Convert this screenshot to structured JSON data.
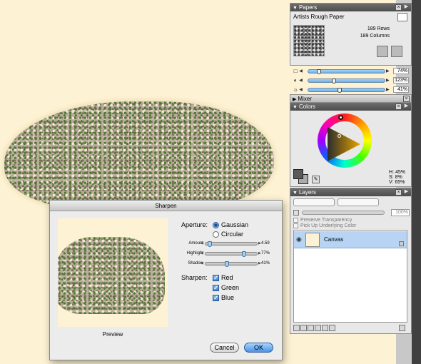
{
  "panels": {
    "papers": {
      "title": "Papers",
      "paper_name": "Artists Rough Paper",
      "rows": "189 Rows",
      "columns": "189 Columns",
      "sliders": [
        {
          "icon": "scale-icon",
          "value": "74%",
          "fraction": 0.12
        },
        {
          "icon": "contrast-icon",
          "value": "123%",
          "fraction": 0.33
        },
        {
          "icon": "brightness-icon",
          "value": "41%",
          "fraction": 0.41
        }
      ]
    },
    "mixer": {
      "title": "Mixer"
    },
    "colors": {
      "title": "Colors",
      "h": "H: 45%",
      "s": "S: 8%",
      "v": "V: 65%"
    },
    "layers": {
      "title": "Layers",
      "opacity": "100%",
      "preserve_transparency": "Preserve Transparency",
      "pick_up_color": "Pick Up Underlying Color",
      "layer_name": "Canvas"
    }
  },
  "dialog": {
    "title": "Sharpen",
    "preview_label": "Preview",
    "aperture_label": "Aperture:",
    "gaussian": "Gaussian",
    "circular": "Circular",
    "amount_label": "Amount",
    "amount_value": "4.59",
    "amount_fraction": 0.05,
    "highlight_label": "Highlight",
    "highlight_value": "77%",
    "highlight_fraction": 0.77,
    "shadow_label": "Shadow",
    "shadow_value": "41%",
    "shadow_fraction": 0.41,
    "sharpen_label": "Sharpen:",
    "red": "Red",
    "green": "Green",
    "blue": "Blue",
    "cancel": "Cancel",
    "ok": "OK"
  },
  "colors": {
    "canvas_bg": "#fdf2d3",
    "accent_blue": "#4a93e6"
  }
}
